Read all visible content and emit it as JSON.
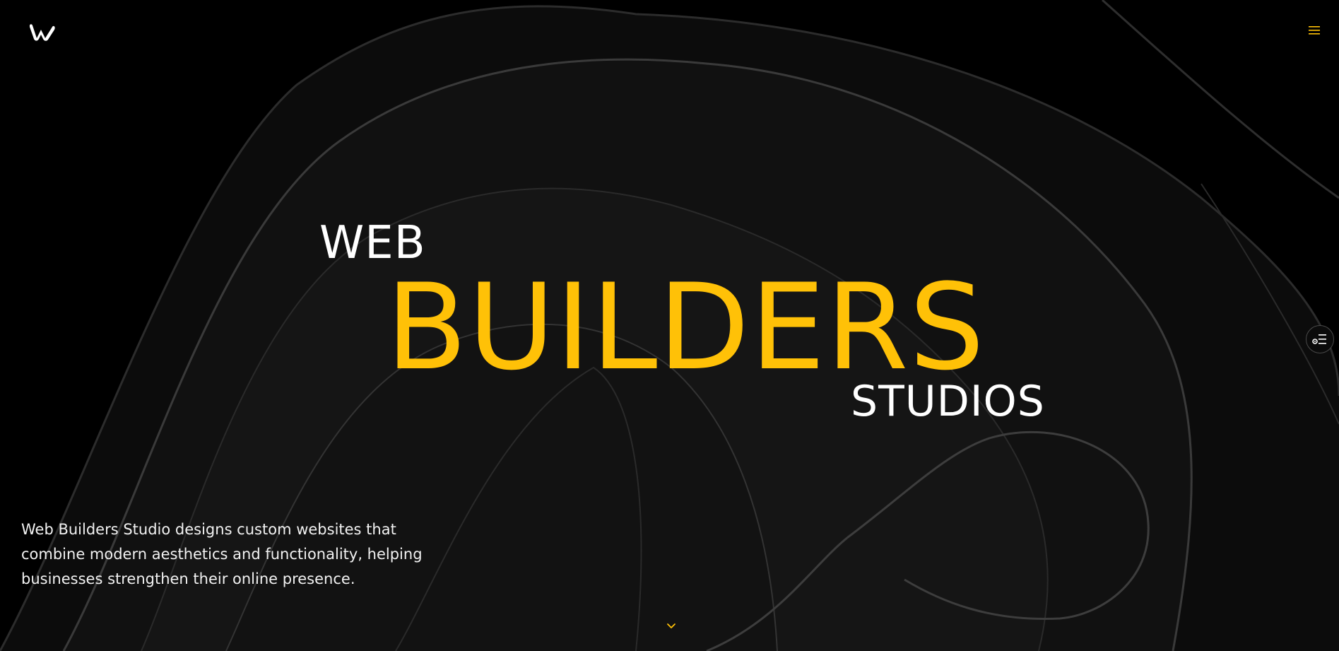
{
  "brand": {
    "logo_icon": "w-logo-icon",
    "accent_color": "#ffc107",
    "background_color": "#000000"
  },
  "header": {
    "menu_icon": "hamburger-menu-icon"
  },
  "hero": {
    "line1": "WEB",
    "line2": "BUILDERS",
    "line3": "STUDIOS"
  },
  "description": "Web Builders Studio designs custom websites that combine modern aesthetics and functionality, helping businesses strengthen their online presence.",
  "side_widget": {
    "icon": "settings-list-icon"
  },
  "scroll": {
    "icon": "chevron-down-icon"
  }
}
